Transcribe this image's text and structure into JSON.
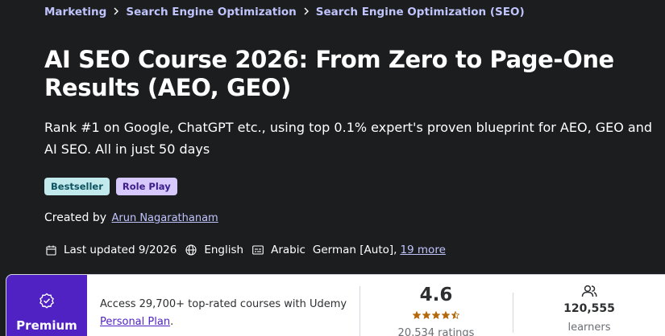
{
  "breadcrumb": [
    {
      "label": "Marketing"
    },
    {
      "label": "Search Engine Optimization"
    },
    {
      "label": "Search Engine Optimization (SEO)"
    }
  ],
  "course": {
    "title": "AI SEO Course 2026: From Zero to Page-One Results (AEO, GEO)",
    "subtitle": "Rank #1 on Google, ChatGPT etc., using top 0.1% expert's proven blueprint for AEO, GEO and AI SEO. All in just 50 days",
    "badges": [
      "Bestseller",
      "Role Play"
    ],
    "created_by_label": "Created by",
    "instructor": "Arun Nagarathanam",
    "last_updated": "Last updated 9/2026",
    "language": "English",
    "captions": "Arabic",
    "captions_more": "German [Auto],",
    "captions_more_link": "19 more"
  },
  "card": {
    "premium_label": "Premium",
    "access_text": "Access 29,700+ top-rated courses with Udemy",
    "plan_link": "Personal Plan",
    "plan_suffix": ".",
    "rating": "4.6",
    "rating_stars": 4.5,
    "ratings_count": "20,534 ratings",
    "learners_count": "120,555",
    "learners_label": "learners"
  },
  "colors": {
    "background": "#1c1d1f",
    "link": "#c0c4fc",
    "premium": "#5022c3",
    "star": "#b4690e"
  },
  "icons": {
    "meta": [
      "calendar-icon",
      "globe-icon",
      "captions-icon"
    ],
    "premium": "badge-check-icon",
    "learners": "users-icon"
  }
}
